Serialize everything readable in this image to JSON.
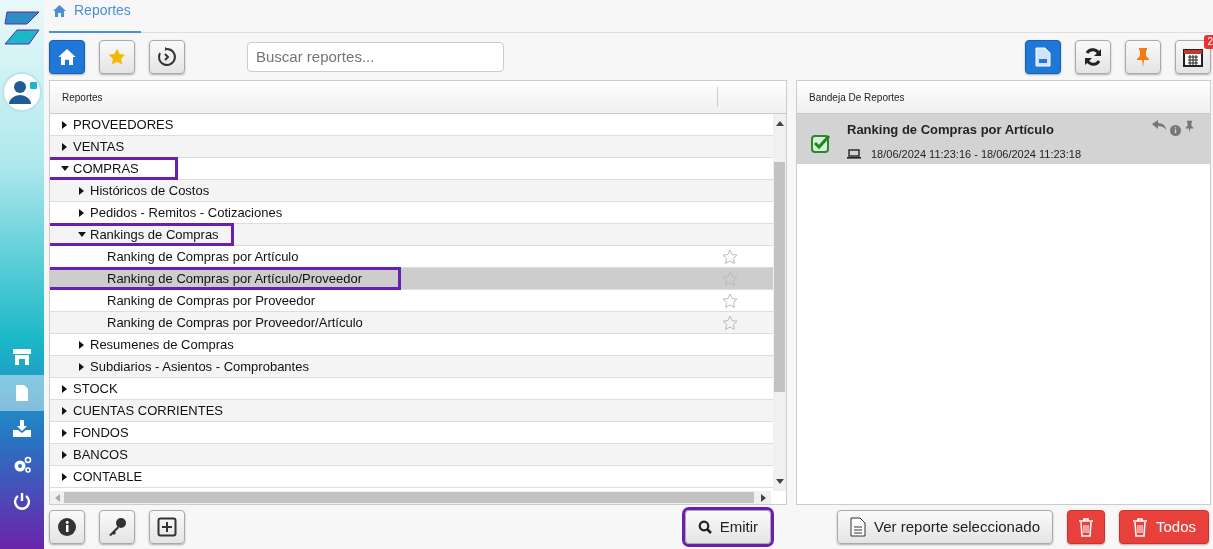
{
  "sidebar": {
    "items": [
      {
        "kind": "store",
        "selected": false
      },
      {
        "kind": "document",
        "selected": true
      },
      {
        "kind": "download",
        "selected": false
      },
      {
        "kind": "settings",
        "selected": false
      },
      {
        "kind": "power",
        "selected": false
      }
    ]
  },
  "breadcrumb": {
    "label": "Reportes"
  },
  "toolbar": {
    "search": {
      "placeholder": "Buscar reportes..."
    },
    "calendar_badge": "2"
  },
  "tree": {
    "header": "Reportes",
    "nodes": [
      {
        "label": "PROVEEDORES",
        "expanded": false,
        "highlighted": false,
        "selected": false
      },
      {
        "label": "VENTAS",
        "expanded": false,
        "highlighted": false,
        "selected": false
      },
      {
        "label": "COMPRAS",
        "expanded": true,
        "highlighted": true,
        "selected": false,
        "children": [
          {
            "label": "Históricos de Costos",
            "expanded": false,
            "highlighted": false,
            "selected": false
          },
          {
            "label": "Pedidos - Remitos - Cotizaciones",
            "expanded": false,
            "highlighted": false,
            "selected": false
          },
          {
            "label": "Rankings de Compras",
            "expanded": true,
            "highlighted": true,
            "selected": false,
            "children": [
              {
                "label": "Ranking de Compras por Artículo",
                "kind": "report",
                "starred": false,
                "highlighted": false,
                "selected": false
              },
              {
                "label": "Ranking de Compras por Artículo/Proveedor",
                "kind": "report",
                "starred": false,
                "highlighted": true,
                "selected": true
              },
              {
                "label": "Ranking de Compras por Proveedor",
                "kind": "report",
                "starred": false,
                "highlighted": false,
                "selected": false
              },
              {
                "label": "Ranking de Compras por Proveedor/Artículo",
                "kind": "report",
                "starred": false,
                "highlighted": false,
                "selected": false
              }
            ]
          },
          {
            "label": "Resumenes de Compras",
            "expanded": false,
            "highlighted": false,
            "selected": false
          },
          {
            "label": "Subdiarios - Asientos - Comprobantes",
            "expanded": false,
            "highlighted": false,
            "selected": false
          }
        ]
      },
      {
        "label": "STOCK",
        "expanded": false,
        "highlighted": false,
        "selected": false
      },
      {
        "label": "CUENTAS CORRIENTES",
        "expanded": false,
        "highlighted": false,
        "selected": false
      },
      {
        "label": "FONDOS",
        "expanded": false,
        "highlighted": false,
        "selected": false
      },
      {
        "label": "BANCOS",
        "expanded": false,
        "highlighted": false,
        "selected": false
      },
      {
        "label": "CONTABLE",
        "expanded": false,
        "highlighted": false,
        "selected": false
      }
    ]
  },
  "tray": {
    "header": "Bandeja De Reportes",
    "items": [
      {
        "title": "Ranking de Compras por Artículo",
        "time": "18/06/2024 11:23:16 - 18/06/2024 11:23:18",
        "done": true,
        "selected": true
      }
    ]
  },
  "bottom": {
    "emit": {
      "label": "Emitir",
      "highlighted": true
    },
    "view": {
      "label": "Ver reporte seleccionado"
    },
    "delete_all": {
      "label": "Todos"
    }
  }
}
